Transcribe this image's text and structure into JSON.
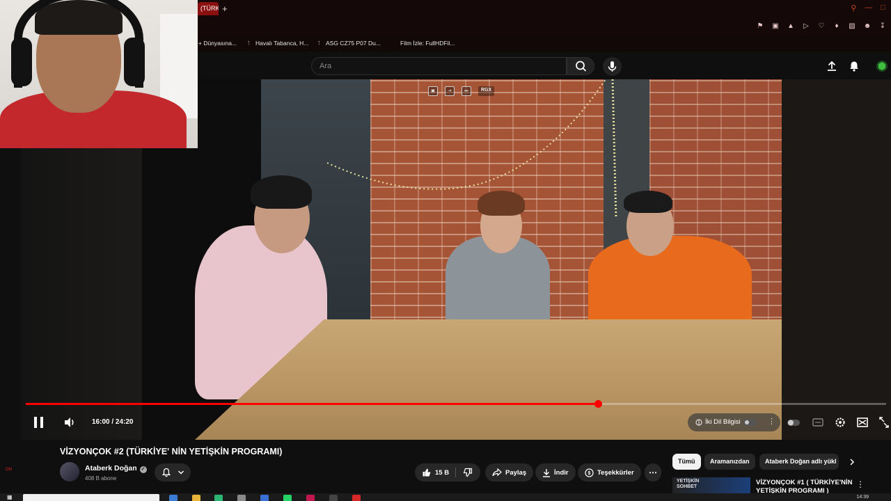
{
  "browser": {
    "active_tab_label": "(TÜRK",
    "new_tab_symbol": "+",
    "bookmarks": [
      {
        "label": "+ Dünyasına..."
      },
      {
        "label": "Havalı Tabanca, H..."
      },
      {
        "label": "ASG CZ75 P07 Du..."
      },
      {
        "label": "Film İzle: FullHDFil..."
      }
    ]
  },
  "header": {
    "search_placeholder": "Ara"
  },
  "player": {
    "time": "16:00 / 24:20",
    "progress": 0.6653,
    "overlay_tag": "RGX",
    "dub_label": "İki Dil Bilgisi"
  },
  "video": {
    "title": "VİZYONÇOK #2 (TÜRKİYE' NİN YETİŞKİN PROGRAMI)",
    "channel": "Ataberk Doğan",
    "subscribers": "408 B abone",
    "likes": "15 B",
    "share_label": "Paylaş",
    "download_label": "İndir",
    "thanks_label": "Teşekkürler"
  },
  "recommendations": {
    "chips": [
      {
        "label": "Tümü",
        "active": true
      },
      {
        "label": "Aramanızdan",
        "active": false
      },
      {
        "label": "Ataberk Doğan adlı yükl",
        "active": false
      }
    ],
    "first": {
      "title": "VİZYONÇOK #1 ( TÜRKİYE'NİN YETİŞKİN PROGRAMI )",
      "thumb_text": "YETİŞKİN SOHBET"
    }
  },
  "taskbar": {
    "clock": "14:39",
    "side_label": "ON"
  },
  "colors": {
    "accent": "#ff0000",
    "background": "#0f0f0f",
    "chip_bg": "#272727"
  }
}
